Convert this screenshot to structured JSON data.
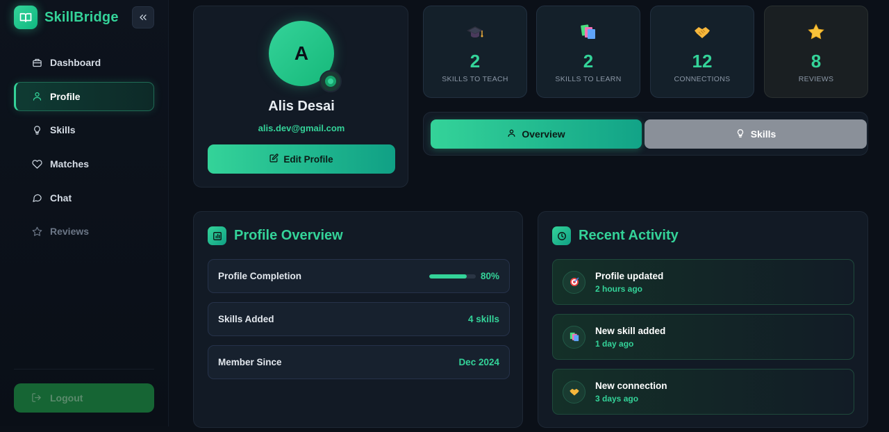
{
  "app": {
    "name": "SkillBridge"
  },
  "sidebar": {
    "items": [
      {
        "label": "Dashboard",
        "icon": "briefcase-icon"
      },
      {
        "label": "Profile",
        "icon": "user-icon"
      },
      {
        "label": "Skills",
        "icon": "lightbulb-icon"
      },
      {
        "label": "Matches",
        "icon": "heart-icon"
      },
      {
        "label": "Chat",
        "icon": "chat-bubble-icon"
      },
      {
        "label": "Reviews",
        "icon": "star-icon"
      }
    ],
    "active": "Profile",
    "logout_label": "Logout"
  },
  "profile": {
    "avatar_letter": "A",
    "name": "Alis Desai",
    "email": "alis.dev@gmail.com",
    "edit_label": "Edit Profile"
  },
  "stats": [
    {
      "value": "2",
      "label": "SKILLS TO TEACH",
      "icon": "graduation-cap-icon"
    },
    {
      "value": "2",
      "label": "SKILLS TO LEARN",
      "icon": "books-icon"
    },
    {
      "value": "12",
      "label": "CONNECTIONS",
      "icon": "handshake-icon"
    },
    {
      "value": "8",
      "label": "REVIEWS",
      "icon": "star-icon"
    }
  ],
  "tabs": [
    {
      "label": "Overview",
      "icon": "user-icon",
      "active": true
    },
    {
      "label": "Skills",
      "icon": "lightbulb-icon",
      "active": false
    }
  ],
  "overview": {
    "title": "Profile Overview",
    "rows": [
      {
        "label": "Profile Completion",
        "value": "80%",
        "progress": 0.8
      },
      {
        "label": "Skills Added",
        "value": "4 skills"
      },
      {
        "label": "Member Since",
        "value": "Dec 2024"
      }
    ]
  },
  "activity": {
    "title": "Recent Activity",
    "items": [
      {
        "title": "Profile updated",
        "time": "2 hours ago",
        "icon": "target-icon"
      },
      {
        "title": "New skill added",
        "time": "1 day ago",
        "icon": "books-icon"
      },
      {
        "title": "New connection",
        "time": "3 days ago",
        "icon": "handshake-icon"
      }
    ]
  },
  "colors": {
    "accent": "#34d399",
    "background": "#0b1018",
    "card": "#121a25",
    "logout": "#166534"
  }
}
